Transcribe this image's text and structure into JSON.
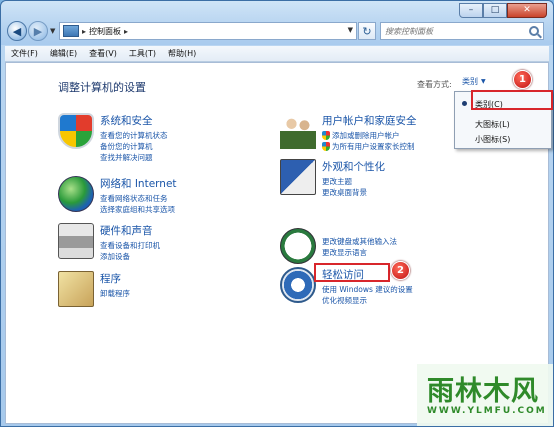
{
  "window": {
    "controls": [
      "–",
      "□",
      "✕"
    ]
  },
  "address_bar": {
    "root_glyph": "▸",
    "path": "控制面板",
    "separator": "▸"
  },
  "search": {
    "placeholder": "搜索控制面板"
  },
  "menu": [
    "文件(F)",
    "编辑(E)",
    "查看(V)",
    "工具(T)",
    "帮助(H)"
  ],
  "page": {
    "title": "调整计算机的设置",
    "view_by_label": "查看方式:",
    "view_by_value": "类别"
  },
  "categories": [
    {
      "title": "系统和安全",
      "links": [
        "查看您的计算机状态",
        "备份您的计算机",
        "查找并解决问题"
      ]
    },
    {
      "title": "网络和 Internet",
      "links": [
        "查看网络状态和任务",
        "选择家庭组和共享选项"
      ]
    },
    {
      "title": "硬件和声音",
      "links": [
        "查看设备和打印机",
        "添加设备"
      ]
    },
    {
      "title": "程序",
      "links": [
        "卸载程序"
      ]
    },
    {
      "title": "用户帐户和家庭安全",
      "links": [
        "添加或删除用户帐户",
        "为所有用户设置家长控制"
      ]
    },
    {
      "title": "外观和个性化",
      "links": [
        "更改主题",
        "更改桌面背景"
      ]
    },
    {
      "title": "",
      "links": [
        "更改键盘或其他输入法",
        "更改显示语言"
      ]
    },
    {
      "title": "轻松访问",
      "links": [
        "使用 Windows 建议的设置",
        "优化视频显示"
      ]
    }
  ],
  "dropdown": {
    "items": [
      "类别(C)",
      "大图标(L)",
      "小图标(S)"
    ],
    "selected": 0
  },
  "annotations": {
    "badge1": "1",
    "badge2": "2"
  },
  "watermark": {
    "title": "雨林木风",
    "url": "WWW.YLMFU.COM"
  },
  "colors": {
    "link": "#1a55a8",
    "highlight": "#d8262b",
    "watermark": "#2f8a2a"
  }
}
